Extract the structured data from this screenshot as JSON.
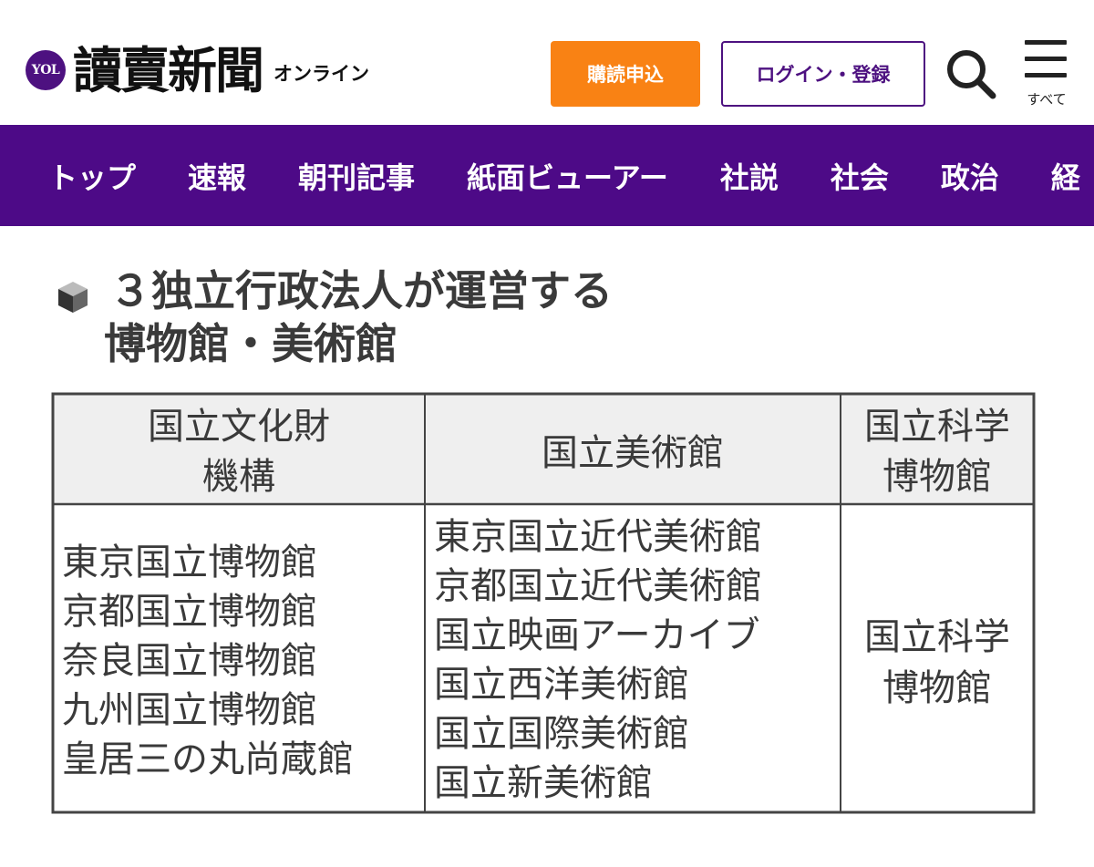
{
  "header": {
    "logo_badge": "YOL",
    "logo_name": "讀賣新聞",
    "logo_sub": "オンライン",
    "subscribe_label": "購読申込",
    "login_label": "ログイン・登録",
    "menu_label": "すべて"
  },
  "nav": {
    "items": [
      "トップ",
      "速報",
      "朝刊記事",
      "紙面ビューアー",
      "社説",
      "社会",
      "政治",
      "経"
    ]
  },
  "figure": {
    "title_line1": "３独立行政法人が運営する",
    "title_line2": "博物館・美術館",
    "columns": [
      {
        "header_line1": "国立文化財",
        "header_line2": "機構",
        "items": [
          "東京国立博物館",
          "京都国立博物館",
          "奈良国立博物館",
          "九州国立博物館",
          "皇居三の丸尚蔵館"
        ]
      },
      {
        "header_line1": "国立美術館",
        "header_line2": "",
        "items": [
          "東京国立近代美術館",
          "京都国立近代美術館",
          "国立映画アーカイブ",
          "国立西洋美術館",
          "国立国際美術館",
          "国立新美術館"
        ]
      },
      {
        "header_line1": "国立科学",
        "header_line2": "博物館",
        "items": [
          "国立科学",
          "博物館"
        ]
      }
    ]
  },
  "colors": {
    "brand_purple": "#4d0a87",
    "subscribe_orange": "#f98214"
  }
}
